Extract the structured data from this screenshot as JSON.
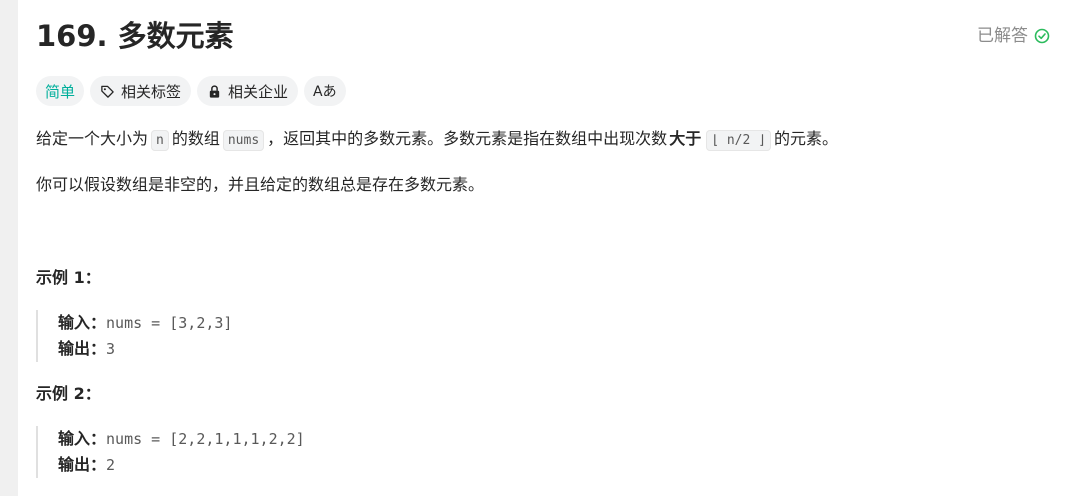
{
  "problem": {
    "title": "169. 多数元素",
    "status": "已解答",
    "status_color": "#2cbb5d"
  },
  "tags": {
    "difficulty": "简单",
    "difficulty_color": "#00af9b",
    "related_tags": "相关标签",
    "related_companies": "相关企业",
    "font_toggle": "Aあ"
  },
  "description": {
    "p1_a": "给定一个大小为",
    "p1_code_n": "n",
    "p1_b": "的数组",
    "p1_code_nums": "nums",
    "p1_c": "，返回其中的多数元素。多数元素是指在数组中出现次数",
    "p1_strong": "大于",
    "p1_code_n2": "⌊ n/2 ⌋",
    "p1_d": "的元素。",
    "p2": "你可以假设数组是非空的，并且给定的数组总是存在多数元素。"
  },
  "examples": [
    {
      "title": "示例 1：",
      "input_label": "输入：",
      "input_value": "nums = [3,2,3]",
      "output_label": "输出：",
      "output_value": "3"
    },
    {
      "title": "示例 2：",
      "input_label": "输入：",
      "input_value": "nums = [2,2,1,1,1,2,2]",
      "output_label": "输出：",
      "output_value": "2"
    }
  ]
}
